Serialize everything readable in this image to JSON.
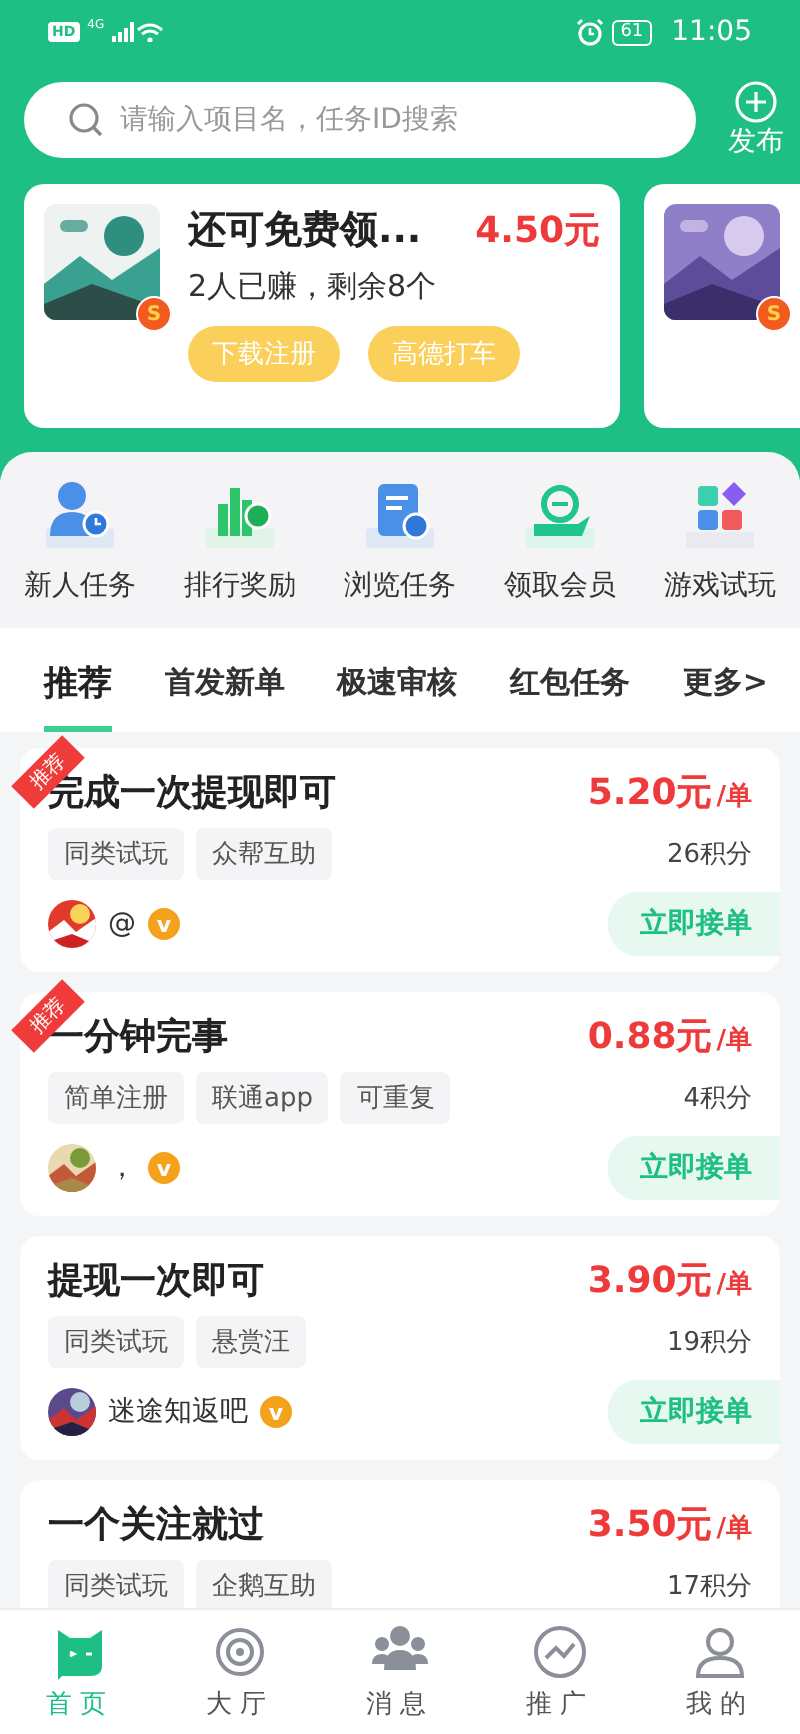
{
  "status_bar": {
    "network_badge": "HD",
    "network_type": "4G",
    "battery": "61",
    "time": "11:05"
  },
  "search": {
    "placeholder": "请输入项目名，任务ID搜索"
  },
  "publish": {
    "label": "发布"
  },
  "banners": [
    {
      "kind": "offer",
      "title": "还可免费领...",
      "price": "4.50元",
      "subtitle": "2人已赚，剩余8个",
      "badge": "S",
      "buttons": [
        "下载注册",
        "高德打车"
      ]
    },
    {
      "kind": "thumb",
      "badge": "S"
    }
  ],
  "shortcuts": [
    {
      "label": "新人任务",
      "kind": "user"
    },
    {
      "label": "排行奖励",
      "kind": "rank"
    },
    {
      "label": "浏览任务",
      "kind": "doc"
    },
    {
      "label": "领取会员",
      "kind": "vip"
    },
    {
      "label": "游戏试玩",
      "kind": "game"
    }
  ],
  "tabs": [
    {
      "label": "推荐",
      "selected": true
    },
    {
      "label": "首发新单",
      "selected": false
    },
    {
      "label": "极速审核",
      "selected": false
    },
    {
      "label": "红包任务",
      "selected": false
    },
    {
      "label": "更多>",
      "selected": false
    }
  ],
  "tasks": [
    {
      "recommended": true,
      "ribbon": "推荐",
      "title": "完成一次提现即可",
      "price": "5.20元",
      "unit": "/单",
      "tags": [
        "同类试玩",
        "众帮互助"
      ],
      "points": "26积分",
      "user": "@",
      "verified": true,
      "verified_mark": "v",
      "action": "立即接单"
    },
    {
      "recommended": true,
      "ribbon": "推荐",
      "title": "一分钟完事",
      "price": "0.88元",
      "unit": "/单",
      "tags": [
        "简单注册",
        "联通app",
        "可重复"
      ],
      "points": "4积分",
      "user": "，",
      "verified": true,
      "verified_mark": "v",
      "action": "立即接单"
    },
    {
      "recommended": false,
      "title": "提现一次即可",
      "price": "3.90元",
      "unit": "/单",
      "tags": [
        "同类试玩",
        "悬赏汪"
      ],
      "points": "19积分",
      "user": "迷途知返吧",
      "verified": true,
      "verified_mark": "v",
      "action": "立即接单"
    },
    {
      "recommended": false,
      "title": "一个关注就过",
      "price": "3.50元",
      "unit": "/单",
      "tags": [
        "同类试玩",
        "企鹅互助"
      ],
      "points": "17积分"
    }
  ],
  "nav": [
    {
      "label": "首页",
      "kind": "home",
      "selected": true
    },
    {
      "label": "大厅",
      "kind": "hall",
      "selected": false
    },
    {
      "label": "消息",
      "kind": "msg",
      "selected": false
    },
    {
      "label": "推广",
      "kind": "promo",
      "selected": false
    },
    {
      "label": "我的",
      "kind": "me",
      "selected": false
    }
  ]
}
